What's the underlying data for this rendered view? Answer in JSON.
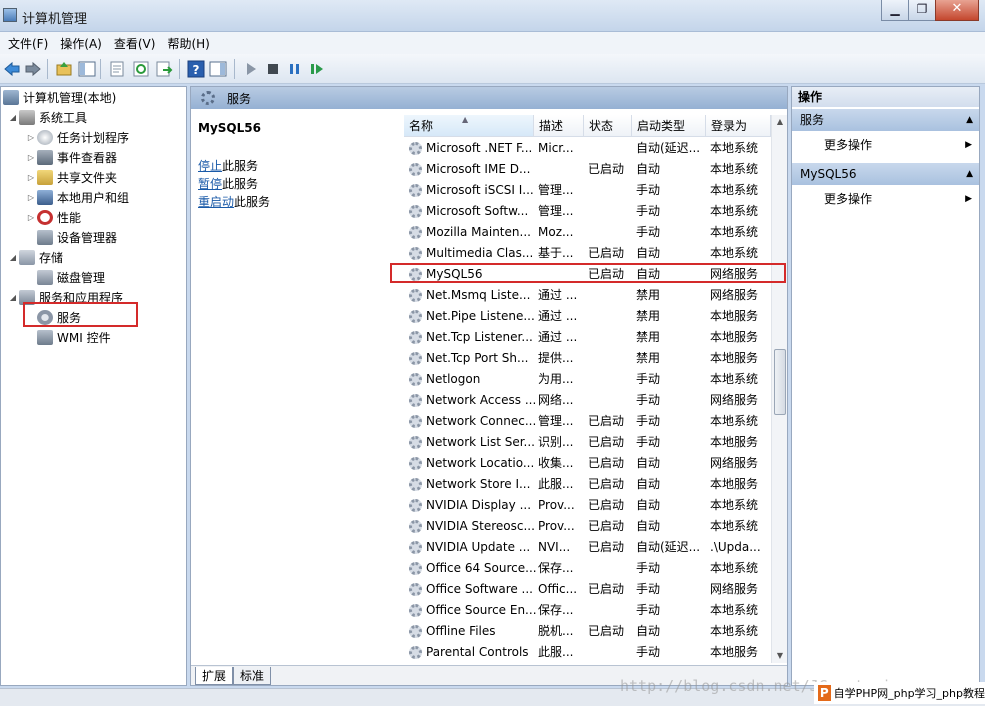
{
  "window": {
    "title": "计算机管理"
  },
  "menubar": [
    "文件(F)",
    "操作(A)",
    "查看(V)",
    "帮助(H)"
  ],
  "tree": {
    "root": "计算机管理(本地)",
    "system_tools": "系统工具",
    "task_scheduler": "任务计划程序",
    "event_viewer": "事件查看器",
    "shared_folders": "共享文件夹",
    "local_users": "本地用户和组",
    "performance": "性能",
    "device_manager": "设备管理器",
    "storage": "存储",
    "disk_management": "磁盘管理",
    "services_apps": "服务和应用程序",
    "services": "服务",
    "wmi": "WMI 控件"
  },
  "center": {
    "header": "服务",
    "selected_service": "MySQL56",
    "actions": [
      {
        "link": "停止",
        "rest": "此服务"
      },
      {
        "link": "暂停",
        "rest": "此服务"
      },
      {
        "link": "重启动",
        "rest": "此服务"
      }
    ],
    "columns": [
      "名称",
      "描述",
      "状态",
      "启动类型",
      "登录为"
    ],
    "rows": [
      [
        "Microsoft .NET F...",
        "Micr...",
        "",
        "自动(延迟...",
        "本地系统"
      ],
      [
        "Microsoft IME D...",
        "",
        "已启动",
        "自动",
        "本地系统"
      ],
      [
        "Microsoft iSCSI I...",
        "管理...",
        "",
        "手动",
        "本地系统"
      ],
      [
        "Microsoft Softw...",
        "管理...",
        "",
        "手动",
        "本地系统"
      ],
      [
        "Mozilla Mainten...",
        "Moz...",
        "",
        "手动",
        "本地系统"
      ],
      [
        "Multimedia Clas...",
        "基于...",
        "已启动",
        "自动",
        "本地系统"
      ],
      [
        "MySQL56",
        "",
        "已启动",
        "自动",
        "网络服务"
      ],
      [
        "Net.Msmq Liste...",
        "通过 ...",
        "",
        "禁用",
        "网络服务"
      ],
      [
        "Net.Pipe Listene...",
        "通过 ...",
        "",
        "禁用",
        "本地服务"
      ],
      [
        "Net.Tcp Listener...",
        "通过 ...",
        "",
        "禁用",
        "本地服务"
      ],
      [
        "Net.Tcp Port Sh...",
        "提供...",
        "",
        "禁用",
        "本地服务"
      ],
      [
        "Netlogon",
        "为用...",
        "",
        "手动",
        "本地系统"
      ],
      [
        "Network Access ...",
        "网络...",
        "",
        "手动",
        "网络服务"
      ],
      [
        "Network Connec...",
        "管理...",
        "已启动",
        "手动",
        "本地系统"
      ],
      [
        "Network List Ser...",
        "识别...",
        "已启动",
        "手动",
        "本地服务"
      ],
      [
        "Network Locatio...",
        "收集...",
        "已启动",
        "自动",
        "网络服务"
      ],
      [
        "Network Store I...",
        "此服...",
        "已启动",
        "自动",
        "本地服务"
      ],
      [
        "NVIDIA Display ...",
        "Prov...",
        "已启动",
        "自动",
        "本地系统"
      ],
      [
        "NVIDIA Stereosc...",
        "Prov...",
        "已启动",
        "自动",
        "本地系统"
      ],
      [
        "NVIDIA Update ...",
        "NVI...",
        "已启动",
        "自动(延迟...",
        ".\\Upda..."
      ],
      [
        "Office 64 Source...",
        "保存...",
        "",
        "手动",
        "本地系统"
      ],
      [
        "Office Software ...",
        "Offic...",
        "已启动",
        "手动",
        "网络服务"
      ],
      [
        "Office Source En...",
        "保存...",
        "",
        "手动",
        "本地系统"
      ],
      [
        "Offline Files",
        "脱机...",
        "已启动",
        "自动",
        "本地系统"
      ],
      [
        "Parental Controls",
        "此服...",
        "",
        "手动",
        "本地服务"
      ]
    ],
    "tabs": [
      "扩展",
      "标准"
    ]
  },
  "right": {
    "header": "操作",
    "section1": "服务",
    "more1": "更多操作",
    "section2": "MySQL56",
    "more2": "更多操作"
  },
  "watermark": {
    "url": "http://blog.csdn.net/JCmastering",
    "badge": "自学PHP网_php学习_php教程"
  },
  "colors": {
    "highlight_box": "#d42a2a",
    "link": "#1a5aa8"
  }
}
